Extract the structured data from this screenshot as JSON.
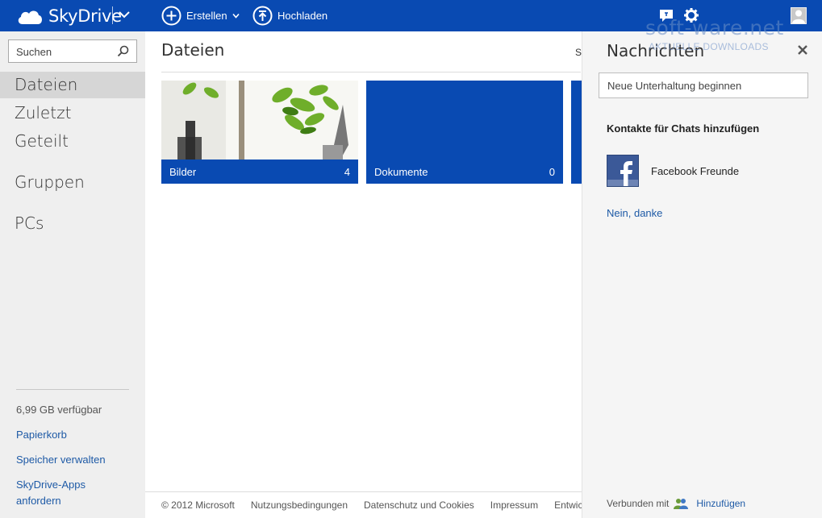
{
  "app": {
    "brand": "SkyDrive"
  },
  "toolbar": {
    "create_label": "Erstellen",
    "upload_label": "Hochladen"
  },
  "icons": {
    "cloud": "cloud-icon",
    "chevron": "chevron-down-icon",
    "plus": "plus-circle-icon",
    "upload": "upload-circle-icon",
    "chat": "chat-icon",
    "settings": "gear-icon",
    "user": "user-avatar-icon",
    "search": "search-icon",
    "close": "close-icon",
    "facebook": "facebook-icon",
    "connect": "people-icon"
  },
  "sidebar": {
    "search_placeholder": "Suchen",
    "items": [
      {
        "label": "Dateien",
        "active": true
      },
      {
        "label": "Zuletzt"
      },
      {
        "label": "Geteilt"
      },
      {
        "label": "Gruppen"
      },
      {
        "label": "PCs"
      }
    ],
    "storage": "6,99 GB verfügbar",
    "links": [
      "Papierkorb",
      "Speicher verwalten",
      "SkyDrive-Apps anfordern"
    ]
  },
  "main": {
    "title": "Dateien",
    "sort_peek": "So",
    "tiles": [
      {
        "name": "Bilder",
        "count": "4"
      },
      {
        "name": "Dokumente",
        "count": "0"
      },
      {
        "name": "",
        "count": ""
      }
    ]
  },
  "footer": {
    "copyright": "© 2012 Microsoft",
    "links": [
      "Nutzungsbedingungen",
      "Datenschutz und Cookies",
      "Impressum",
      "Entwic"
    ]
  },
  "chat_panel": {
    "title": "Nachrichten",
    "input_placeholder": "Neue Unterhaltung beginnen",
    "heading": "Kontakte für Chats hinzufügen",
    "facebook_label": "Facebook Freunde",
    "decline_link": "Nein, danke",
    "connected_label": "Verbunden mit",
    "add_link": "Hinzufügen"
  },
  "watermark": {
    "line1": "soft-ware.net",
    "line2": "AKTUELLE DOWNLOADS"
  },
  "colors": {
    "accent": "#094ab2",
    "sidebar_bg": "#efefef",
    "panel_bg": "#f5f5f5",
    "link": "#1e5aa6"
  }
}
